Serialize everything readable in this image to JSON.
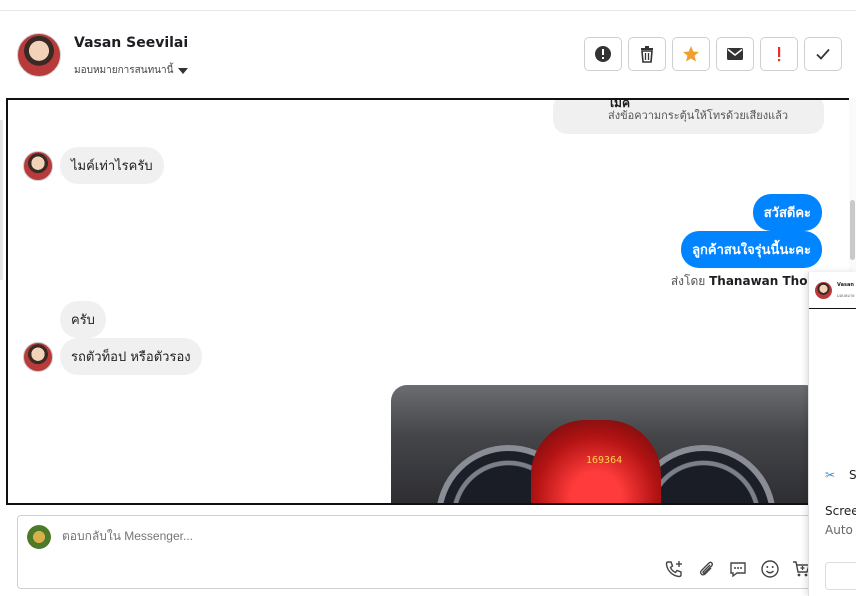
{
  "header": {
    "contact_name": "Vasan Seevilai",
    "assign_label": "มอบหมายการสนทนานี้",
    "actions": [
      {
        "name": "spam-icon",
        "label": "!"
      },
      {
        "name": "trash-icon",
        "label": ""
      },
      {
        "name": "star-icon",
        "label": ""
      },
      {
        "name": "envelope-icon",
        "label": ""
      },
      {
        "name": "important-icon",
        "label": "!"
      },
      {
        "name": "check-icon",
        "label": ""
      }
    ],
    "colors": {
      "star": "#f0a030",
      "important": "#e03030"
    }
  },
  "conversation": {
    "call_card": {
      "title": "ไมค์",
      "subtitle": "ส่งข้อความกระตุ้นให้โทรด้วยเสียงแล้ว"
    },
    "messages": [
      {
        "from": "contact",
        "text": "ไมค์เท่าไรครับ"
      },
      {
        "from": "page",
        "text": "สวัสดีคะ"
      },
      {
        "from": "page",
        "text": "ลูกค้าสนใจรุ่นนี้นะคะ"
      },
      {
        "from": "contact",
        "text": "ครับ"
      },
      {
        "from": "contact",
        "text": "รถตัวท็อป หรือตัวรอง"
      }
    ],
    "sent_by_prefix": "ส่งโดย",
    "sent_by_name": "Thanawan Thon",
    "photo_odometer": "169364",
    "colors": {
      "outgoing": "#0084ff",
      "incoming": "#f0f0f0"
    }
  },
  "composer": {
    "placeholder": "ตอบกลับใน Messenger..."
  },
  "side_panel": {
    "name": "Vasan",
    "sub": "มอบหมาย",
    "s_label": "S",
    "text_line1": "Scree",
    "text_line2": "Auto"
  }
}
